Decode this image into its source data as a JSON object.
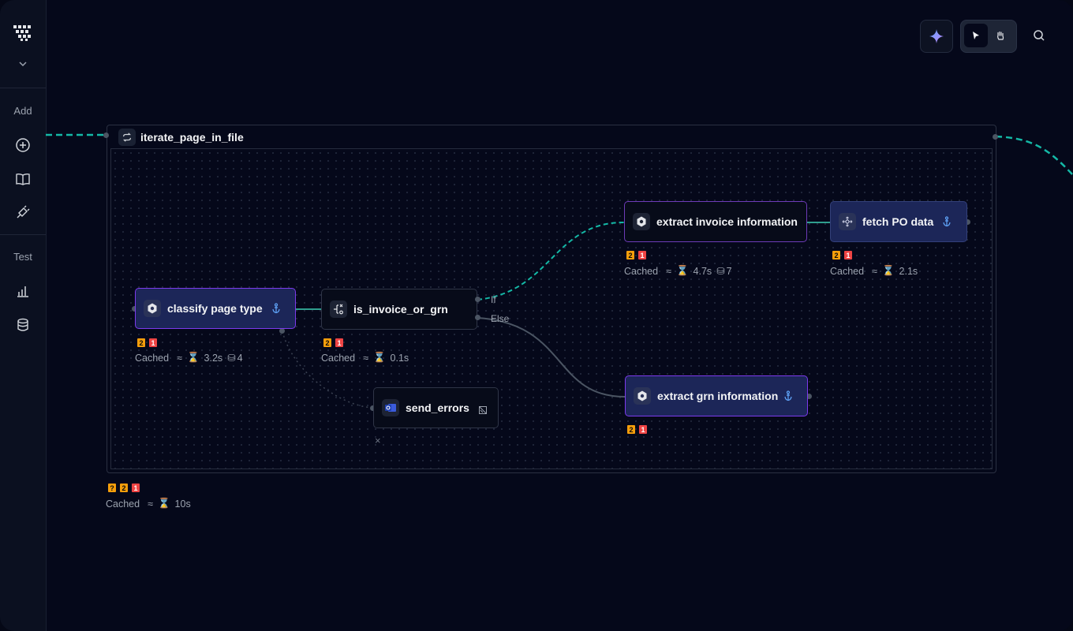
{
  "sidebar": {
    "add_label": "Add",
    "test_label": "Test"
  },
  "group": {
    "title": "iterate_page_in_file",
    "badges": [
      "?",
      "2",
      "1"
    ],
    "cached": "Cached",
    "approx": "≈",
    "time": "10s"
  },
  "nodes": {
    "classify": {
      "label": "classify page type",
      "badges": [
        "2",
        "1"
      ],
      "cached": "Cached",
      "approx": "≈",
      "time": "3.2s",
      "tokens": "4"
    },
    "router": {
      "label": "is_invoice_or_grn",
      "badges": [
        "2",
        "1"
      ],
      "cached": "Cached",
      "approx": "≈",
      "time": "0.1s",
      "if_label": "If",
      "else_label": "Else"
    },
    "extract_invoice": {
      "label": "extract invoice information",
      "badges": [
        "2",
        "1"
      ],
      "cached": "Cached",
      "approx": "≈",
      "time": "4.7s",
      "tokens": "7"
    },
    "fetch_po": {
      "label": "fetch PO data",
      "badges": [
        "2",
        "1"
      ],
      "cached": "Cached",
      "approx": "≈",
      "time": "2.1s"
    },
    "extract_grn": {
      "label": "extract grn information",
      "badges": [
        "2",
        "1"
      ]
    },
    "send_errors": {
      "label": "send_errors",
      "close": "×"
    }
  },
  "colors": {
    "background": "#050816",
    "node_fill": "#1c2658",
    "node_border_selected": "#7c3aed",
    "edge_active": "#14b8a6",
    "badge_orange": "#f59e0b",
    "badge_red": "#ef4444",
    "anchor": "#60a5fa"
  }
}
